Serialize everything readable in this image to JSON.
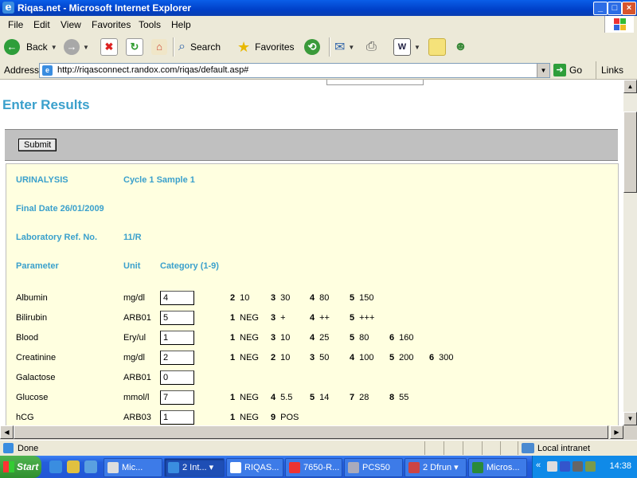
{
  "window": {
    "title": "Riqas.net - Microsoft Internet Explorer"
  },
  "menu": [
    "File",
    "Edit",
    "View",
    "Favorites",
    "Tools",
    "Help"
  ],
  "toolbar": {
    "back": "Back",
    "search": "Search",
    "favorites": "Favorites"
  },
  "address": {
    "label": "Address",
    "url": "http://riqasconnect.randox.com/riqas/default.asp#",
    "go": "Go",
    "links": "Links"
  },
  "page": {
    "title": "Enter Results",
    "submit_label": "Submit",
    "program": "URINALYSIS",
    "cycle_sample": "Cycle 1 Sample 1",
    "final_date": "Final Date 26/01/2009",
    "lab_ref_label": "Laboratory Ref. No.",
    "lab_ref_value": "11/R",
    "col_parameter": "Parameter",
    "col_unit": "Unit",
    "col_category": "Category (1-9)",
    "rows": [
      {
        "parameter": "Albumin",
        "unit": "mg/dl",
        "value": "4",
        "cats": [
          [
            "2",
            "10"
          ],
          [
            "3",
            "30"
          ],
          [
            "4",
            "80"
          ],
          [
            "5",
            "150"
          ]
        ]
      },
      {
        "parameter": "Bilirubin",
        "unit": "ARB01",
        "value": "5",
        "cats": [
          [
            "1",
            "NEG"
          ],
          [
            "3",
            "+"
          ],
          [
            "4",
            "++"
          ],
          [
            "5",
            "+++"
          ]
        ]
      },
      {
        "parameter": "Blood",
        "unit": "Ery/ul",
        "value": "1",
        "cats": [
          [
            "1",
            "NEG"
          ],
          [
            "3",
            "10"
          ],
          [
            "4",
            "25"
          ],
          [
            "5",
            "80"
          ],
          [
            "6",
            "160"
          ]
        ]
      },
      {
        "parameter": "Creatinine",
        "unit": "mg/dl",
        "value": "2",
        "cats": [
          [
            "1",
            "NEG"
          ],
          [
            "2",
            "10"
          ],
          [
            "3",
            "50"
          ],
          [
            "4",
            "100"
          ],
          [
            "5",
            "200"
          ],
          [
            "6",
            "300"
          ]
        ]
      },
      {
        "parameter": "Galactose",
        "unit": "ARB01",
        "value": "0",
        "cats": []
      },
      {
        "parameter": "Glucose",
        "unit": "mmol/l",
        "value": "7",
        "cats": [
          [
            "1",
            "NEG"
          ],
          [
            "4",
            "5.5"
          ],
          [
            "5",
            "14"
          ],
          [
            "7",
            "28"
          ],
          [
            "8",
            "55"
          ]
        ]
      },
      {
        "parameter": "hCG",
        "unit": "ARB03",
        "value": "1",
        "cats": [
          [
            "1",
            "NEG"
          ],
          [
            "9",
            "POS"
          ]
        ]
      }
    ]
  },
  "status": {
    "text": "Done",
    "zone": "Local intranet"
  },
  "taskbar": {
    "start": "Start",
    "tasks": [
      "Mic...",
      "2 Int...",
      "RIQAS...",
      "7650-R...",
      "PCS50",
      "2 Dfrun",
      "Micros..."
    ],
    "clock": "14:38"
  }
}
